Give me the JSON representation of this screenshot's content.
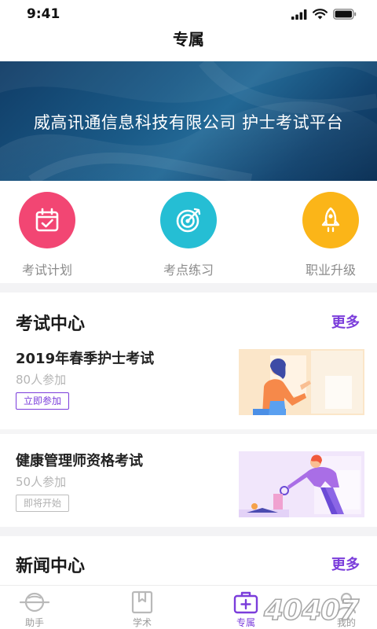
{
  "status_bar": {
    "time": "9:41"
  },
  "header": {
    "title": "专属"
  },
  "banner": {
    "text": "威高讯通信息科技有限公司 护士考试平台"
  },
  "quick_actions": [
    {
      "label": "考试计划",
      "icon": "calendar-check-icon",
      "color": "#f24673"
    },
    {
      "label": "考点练习",
      "icon": "target-icon",
      "color": "#25bed4"
    },
    {
      "label": "职业升级",
      "icon": "rocket-icon",
      "color": "#fbb518"
    }
  ],
  "exam_center": {
    "title": "考试中心",
    "more": "更多",
    "exams": [
      {
        "title": "2019年春季护士考试",
        "count": "80人参加",
        "button": "立即参加",
        "status": "active"
      },
      {
        "title": "健康管理师资格考试",
        "count": "50人参加",
        "button": "即将开始",
        "status": "upcoming"
      }
    ]
  },
  "news_center": {
    "title": "新闻中心",
    "more": "更多"
  },
  "tabs": [
    {
      "label": "助手",
      "icon": "assistant-icon",
      "active": false
    },
    {
      "label": "学术",
      "icon": "bookmark-book-icon",
      "active": false
    },
    {
      "label": "专属",
      "icon": "medical-kit-icon",
      "active": true
    },
    {
      "label": "我的",
      "icon": "profile-icon",
      "active": false
    }
  ],
  "colors": {
    "accent": "#7b3ddb",
    "banner": "#1a5a87"
  },
  "watermark": "40407"
}
